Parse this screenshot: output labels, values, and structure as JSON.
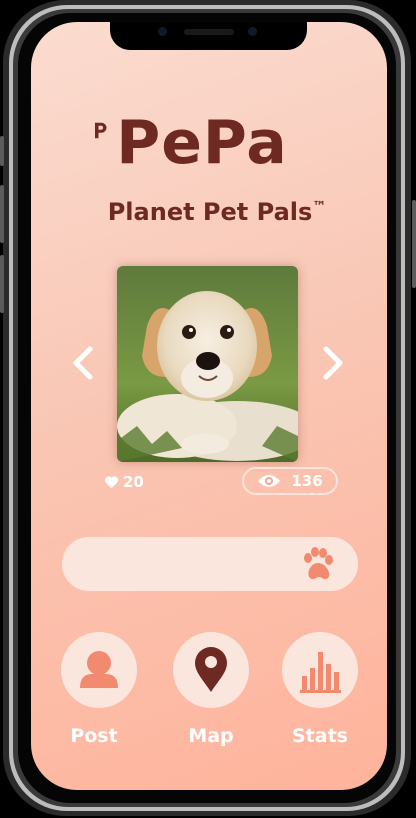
{
  "app": {
    "logo_text": "PePa",
    "tagline": "Planet Pet Pals",
    "trademark": "™"
  },
  "carousel": {
    "photo_alt": "golden retriever puppy",
    "prev": "previous",
    "next": "next"
  },
  "stats": {
    "likes": "20",
    "views": "136"
  },
  "search": {
    "value": ""
  },
  "nav": {
    "post": "Post",
    "map": "Map",
    "stats": "Stats"
  },
  "colors": {
    "brand": "#6e2a22",
    "accent": "#f28a6f",
    "pill": "#fbe6de"
  }
}
